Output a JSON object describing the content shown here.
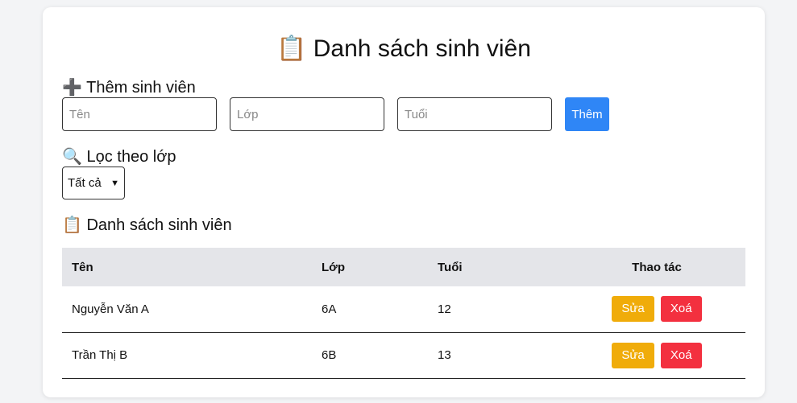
{
  "title": {
    "icon": "clipboard-icon",
    "glyph": "📋",
    "text": "Danh sách sinh viên"
  },
  "add_section": {
    "icon": "plus-icon",
    "glyph": "➕",
    "heading": "Thêm sinh viên",
    "name_placeholder": "Tên",
    "class_placeholder": "Lớp",
    "age_placeholder": "Tuổi",
    "add_label": "Thêm"
  },
  "filter_section": {
    "icon": "magnifier-icon",
    "glyph": "🔍",
    "heading": "Lọc theo lớp",
    "selected": "Tất cả"
  },
  "list_section": {
    "icon": "clipboard-icon",
    "glyph": "📋",
    "heading": "Danh sách sinh viên"
  },
  "table": {
    "headers": [
      "Tên",
      "Lớp",
      "Tuổi",
      "Thao tác"
    ],
    "rows": [
      {
        "name": "Nguyễn Văn A",
        "class": "6A",
        "age": "12",
        "edit": "Sửa",
        "delete": "Xoá"
      },
      {
        "name": "Trần Thị B",
        "class": "6B",
        "age": "13",
        "edit": "Sửa",
        "delete": "Xoá"
      }
    ]
  },
  "colors": {
    "add_button": "#2f86f6",
    "edit_button": "#f0ac0a",
    "delete_button": "#f3303f",
    "header_bg": "#e4e5e9"
  }
}
